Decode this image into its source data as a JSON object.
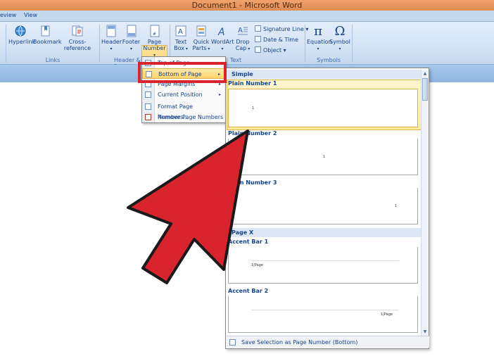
{
  "window": {
    "title": "Document1 - Microsoft Word"
  },
  "tabs": [
    {
      "label": "eview"
    },
    {
      "label": "View"
    }
  ],
  "ribbon": {
    "links_group": {
      "label": "Links",
      "hyperlink": "Hyperlink",
      "bookmark": "Bookmark",
      "cross_reference": "Cross-reference"
    },
    "header_group": {
      "label": "Header & F",
      "header": "Header",
      "footer": "Footer",
      "page_number_line1": "Page",
      "page_number_line2": "Number"
    },
    "text_group": {
      "label": "Text",
      "text_box_line1": "Text",
      "text_box_line2": "Box",
      "quick_parts_line1": "Quick",
      "quick_parts_line2": "Parts",
      "wordart": "WordArt",
      "drop_cap_line1": "Drop",
      "drop_cap_line2": "Cap",
      "signature_line": "Signature Line",
      "date_time": "Date & Time",
      "object": "Object"
    },
    "symbols_group": {
      "label": "Symbols",
      "equation": "Equation",
      "symbol": "Symbol",
      "equation_glyph": "π",
      "symbol_glyph": "Ω"
    }
  },
  "page_number_menu": {
    "items": [
      {
        "label": "Top of Page"
      },
      {
        "label": "Bottom of Page"
      },
      {
        "label": "Page Margins"
      },
      {
        "label": "Current Position"
      },
      {
        "label": "Format Page Numbers..."
      },
      {
        "label": "Remove Page Numbers"
      }
    ]
  },
  "gallery": {
    "section_simple": "Simple",
    "items": [
      {
        "title": "Plain Number 1",
        "num": "1"
      },
      {
        "title": "Plain Number 2",
        "num": "1"
      },
      {
        "title": "Plain Number 3",
        "num": "1"
      }
    ],
    "section_page_x": "Page X",
    "accent_items": [
      {
        "title": "Accent Bar 1",
        "text": "1|Page"
      },
      {
        "title": "Accent Bar 2",
        "text": "1|Page"
      }
    ],
    "footer_label": "Save Selection as Page Number (Bottom)"
  },
  "colors": {
    "accent": "#d9232d",
    "ribbon": "#d4e3f5",
    "title_bar": "#e99a62"
  }
}
